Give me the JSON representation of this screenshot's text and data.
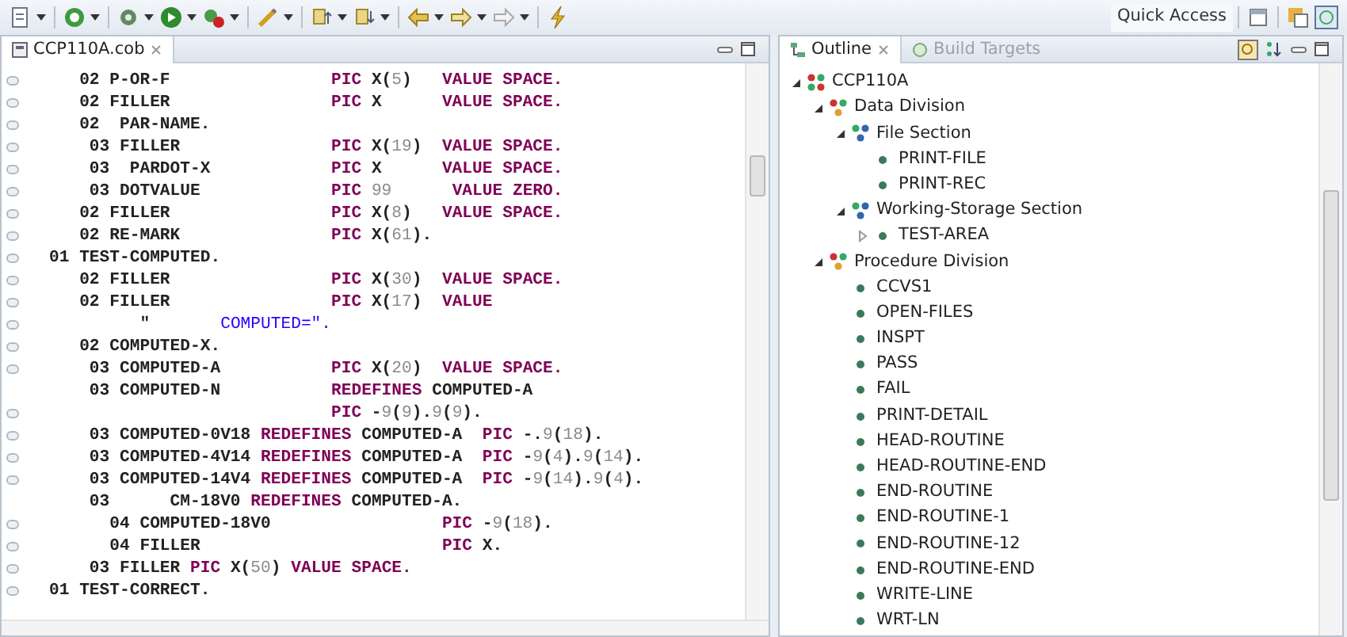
{
  "toolbar": {
    "quick_access": "Quick Access"
  },
  "editor": {
    "tab": {
      "label": "CCP110A.cob",
      "selected": true
    },
    "lines": [
      {
        "fold_marker": true,
        "segments": [
          {
            "kind": "text",
            "text": "   02 P-OR-F                "
          },
          {
            "kind": "kw",
            "text": "PIC"
          },
          {
            "kind": "text",
            "text": " X("
          },
          {
            "kind": "num",
            "text": "5"
          },
          {
            "kind": "text",
            "text": ")   "
          },
          {
            "kind": "kw",
            "text": "VALUE SPACE."
          }
        ]
      },
      {
        "fold_marker": true,
        "segments": [
          {
            "kind": "text",
            "text": "   02 FILLER                "
          },
          {
            "kind": "kw",
            "text": "PIC"
          },
          {
            "kind": "text",
            "text": " X      "
          },
          {
            "kind": "kw",
            "text": "VALUE SPACE."
          }
        ]
      },
      {
        "fold_marker": true,
        "segments": [
          {
            "kind": "text",
            "text": "   02  PAR-NAME."
          }
        ]
      },
      {
        "fold_marker": true,
        "segments": [
          {
            "kind": "text",
            "text": "    03 FILLER               "
          },
          {
            "kind": "kw",
            "text": "PIC"
          },
          {
            "kind": "text",
            "text": " X("
          },
          {
            "kind": "num",
            "text": "19"
          },
          {
            "kind": "text",
            "text": ")  "
          },
          {
            "kind": "kw",
            "text": "VALUE SPACE."
          }
        ]
      },
      {
        "fold_marker": true,
        "segments": [
          {
            "kind": "text",
            "text": "    03  PARDOT-X            "
          },
          {
            "kind": "kw",
            "text": "PIC"
          },
          {
            "kind": "text",
            "text": " X      "
          },
          {
            "kind": "kw",
            "text": "VALUE SPACE."
          }
        ]
      },
      {
        "fold_marker": true,
        "segments": [
          {
            "kind": "text",
            "text": "    03 DOTVALUE             "
          },
          {
            "kind": "kw",
            "text": "PIC"
          },
          {
            "kind": "num",
            "text": " 99"
          },
          {
            "kind": "kw",
            "text": "      VALUE ZERO."
          }
        ]
      },
      {
        "fold_marker": true,
        "segments": [
          {
            "kind": "text",
            "text": "   02 FILLER                "
          },
          {
            "kind": "kw",
            "text": "PIC"
          },
          {
            "kind": "text",
            "text": " X("
          },
          {
            "kind": "num",
            "text": "8"
          },
          {
            "kind": "text",
            "text": ")   "
          },
          {
            "kind": "kw",
            "text": "VALUE SPACE."
          }
        ]
      },
      {
        "fold_marker": true,
        "segments": [
          {
            "kind": "text",
            "text": "   02 RE-MARK               "
          },
          {
            "kind": "kw",
            "text": "PIC"
          },
          {
            "kind": "text",
            "text": " X("
          },
          {
            "kind": "num",
            "text": "61"
          },
          {
            "kind": "text",
            "text": ")."
          }
        ]
      },
      {
        "fold_marker": true,
        "segments": [
          {
            "kind": "text",
            "text": "01 TEST-COMPUTED."
          }
        ]
      },
      {
        "fold_marker": true,
        "segments": [
          {
            "kind": "text",
            "text": "   02 FILLER                "
          },
          {
            "kind": "kw",
            "text": "PIC"
          },
          {
            "kind": "text",
            "text": " X("
          },
          {
            "kind": "num",
            "text": "30"
          },
          {
            "kind": "text",
            "text": ")  "
          },
          {
            "kind": "kw",
            "text": "VALUE SPACE."
          }
        ]
      },
      {
        "fold_marker": true,
        "segments": [
          {
            "kind": "text",
            "text": "   02 FILLER                "
          },
          {
            "kind": "kw",
            "text": "PIC"
          },
          {
            "kind": "text",
            "text": " X("
          },
          {
            "kind": "num",
            "text": "17"
          },
          {
            "kind": "text",
            "text": ")  "
          },
          {
            "kind": "kw",
            "text": "VALUE"
          }
        ]
      },
      {
        "fold_marker": true,
        "segments": [
          {
            "kind": "text",
            "text": "         \"  "
          },
          {
            "kind": "str",
            "text": "     COMPUTED=\"."
          }
        ]
      },
      {
        "fold_marker": true,
        "segments": [
          {
            "kind": "text",
            "text": "   02 COMPUTED-X."
          }
        ]
      },
      {
        "fold_marker": true,
        "segments": [
          {
            "kind": "text",
            "text": "    03 COMPUTED-A           "
          },
          {
            "kind": "kw",
            "text": "PIC"
          },
          {
            "kind": "text",
            "text": " X("
          },
          {
            "kind": "num",
            "text": "20"
          },
          {
            "kind": "text",
            "text": ")  "
          },
          {
            "kind": "kw",
            "text": "VALUE SPACE."
          }
        ]
      },
      {
        "fold_marker": false,
        "segments": [
          {
            "kind": "text",
            "text": "    03 COMPUTED-N           "
          },
          {
            "kind": "kw",
            "text": "REDEFINES"
          },
          {
            "kind": "text",
            "text": " COMPUTED-A"
          }
        ]
      },
      {
        "fold_marker": true,
        "segments": [
          {
            "kind": "kw",
            "text": "                            PIC"
          },
          {
            "kind": "text",
            "text": " -"
          },
          {
            "kind": "num",
            "text": "9"
          },
          {
            "kind": "text",
            "text": "("
          },
          {
            "kind": "num",
            "text": "9"
          },
          {
            "kind": "text",
            "text": ")."
          },
          {
            "kind": "num",
            "text": "9"
          },
          {
            "kind": "text",
            "text": "("
          },
          {
            "kind": "num",
            "text": "9"
          },
          {
            "kind": "text",
            "text": ")."
          }
        ]
      },
      {
        "fold_marker": true,
        "segments": [
          {
            "kind": "text",
            "text": "    03 COMPUTED-0V18 "
          },
          {
            "kind": "kw",
            "text": "REDEFINES"
          },
          {
            "kind": "text",
            "text": " COMPUTED-A  "
          },
          {
            "kind": "kw",
            "text": "PIC"
          },
          {
            "kind": "text",
            "text": " -."
          },
          {
            "kind": "num",
            "text": "9"
          },
          {
            "kind": "text",
            "text": "("
          },
          {
            "kind": "num",
            "text": "18"
          },
          {
            "kind": "text",
            "text": ")."
          }
        ]
      },
      {
        "fold_marker": true,
        "segments": [
          {
            "kind": "text",
            "text": "    03 COMPUTED-4V14 "
          },
          {
            "kind": "kw",
            "text": "REDEFINES"
          },
          {
            "kind": "text",
            "text": " COMPUTED-A  "
          },
          {
            "kind": "kw",
            "text": "PIC"
          },
          {
            "kind": "text",
            "text": " -"
          },
          {
            "kind": "num",
            "text": "9"
          },
          {
            "kind": "text",
            "text": "("
          },
          {
            "kind": "num",
            "text": "4"
          },
          {
            "kind": "text",
            "text": ")."
          },
          {
            "kind": "num",
            "text": "9"
          },
          {
            "kind": "text",
            "text": "("
          },
          {
            "kind": "num",
            "text": "14"
          },
          {
            "kind": "text",
            "text": ")."
          }
        ]
      },
      {
        "fold_marker": true,
        "segments": [
          {
            "kind": "text",
            "text": "    03 COMPUTED-14V4 "
          },
          {
            "kind": "kw",
            "text": "REDEFINES"
          },
          {
            "kind": "text",
            "text": " COMPUTED-A  "
          },
          {
            "kind": "kw",
            "text": "PIC"
          },
          {
            "kind": "text",
            "text": " -"
          },
          {
            "kind": "num",
            "text": "9"
          },
          {
            "kind": "text",
            "text": "("
          },
          {
            "kind": "num",
            "text": "14"
          },
          {
            "kind": "text",
            "text": ")."
          },
          {
            "kind": "num",
            "text": "9"
          },
          {
            "kind": "text",
            "text": "("
          },
          {
            "kind": "num",
            "text": "4"
          },
          {
            "kind": "text",
            "text": ")."
          }
        ]
      },
      {
        "fold_marker": false,
        "segments": [
          {
            "kind": "text",
            "text": "    03      CM-18V0 "
          },
          {
            "kind": "kw",
            "text": "REDEFINES"
          },
          {
            "kind": "text",
            "text": " COMPUTED-A."
          }
        ]
      },
      {
        "fold_marker": true,
        "segments": [
          {
            "kind": "text",
            "text": "      04 COMPUTED-18V0                 "
          },
          {
            "kind": "kw",
            "text": "PIC"
          },
          {
            "kind": "text",
            "text": " -"
          },
          {
            "kind": "num",
            "text": "9"
          },
          {
            "kind": "text",
            "text": "("
          },
          {
            "kind": "num",
            "text": "18"
          },
          {
            "kind": "text",
            "text": ")."
          }
        ]
      },
      {
        "fold_marker": true,
        "segments": [
          {
            "kind": "text",
            "text": "      04 FILLER                        "
          },
          {
            "kind": "kw",
            "text": "PIC"
          },
          {
            "kind": "text",
            "text": " X."
          }
        ]
      },
      {
        "fold_marker": true,
        "segments": [
          {
            "kind": "text",
            "text": "    03 FILLER "
          },
          {
            "kind": "kw",
            "text": "PIC"
          },
          {
            "kind": "text",
            "text": " X("
          },
          {
            "kind": "num",
            "text": "50"
          },
          {
            "kind": "text",
            "text": ") "
          },
          {
            "kind": "kw",
            "text": "VALUE SPACE."
          }
        ]
      },
      {
        "fold_marker": true,
        "segments": [
          {
            "kind": "text",
            "text": "01 TEST-CORRECT."
          }
        ]
      }
    ]
  },
  "outline": {
    "tabs": [
      {
        "label": "Outline",
        "selected": true
      },
      {
        "label": "Build Targets",
        "selected": false
      }
    ],
    "tree": [
      {
        "kind": "program",
        "label": "CCP110A",
        "expanded": true,
        "children": [
          {
            "kind": "division",
            "label": "Data Division",
            "expanded": true,
            "children": [
              {
                "kind": "section",
                "label": "File Section",
                "expanded": true,
                "children": [
                  {
                    "kind": "item",
                    "label": "PRINT-FILE"
                  },
                  {
                    "kind": "item",
                    "label": "PRINT-REC"
                  }
                ]
              },
              {
                "kind": "section",
                "label": "Working-Storage Section",
                "expanded": true,
                "children": [
                  {
                    "kind": "item",
                    "label": "TEST-AREA",
                    "expanded": false
                  }
                ]
              }
            ]
          },
          {
            "kind": "division",
            "label": "Procedure Division",
            "expanded": true,
            "children": [
              {
                "kind": "item",
                "label": "CCVS1"
              },
              {
                "kind": "item",
                "label": "OPEN-FILES"
              },
              {
                "kind": "item",
                "label": "INSPT"
              },
              {
                "kind": "item",
                "label": "PASS"
              },
              {
                "kind": "item",
                "label": "FAIL"
              },
              {
                "kind": "item",
                "label": "PRINT-DETAIL"
              },
              {
                "kind": "item",
                "label": "HEAD-ROUTINE"
              },
              {
                "kind": "item",
                "label": "HEAD-ROUTINE-END"
              },
              {
                "kind": "item",
                "label": "END-ROUTINE"
              },
              {
                "kind": "item",
                "label": "END-ROUTINE-1"
              },
              {
                "kind": "item",
                "label": "END-ROUTINE-12"
              },
              {
                "kind": "item",
                "label": "END-ROUTINE-END"
              },
              {
                "kind": "item",
                "label": "WRITE-LINE"
              },
              {
                "kind": "item",
                "label": "WRT-LN"
              }
            ]
          }
        ]
      }
    ]
  }
}
